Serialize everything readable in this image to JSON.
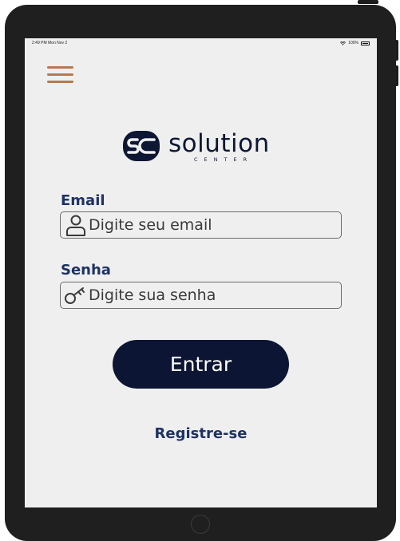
{
  "status_bar": {
    "time": "2:49 PM  Mon Nov 2",
    "battery_text": "100%",
    "wifi_icon": "wifi-icon",
    "battery_icon": "battery-icon"
  },
  "menu": {
    "icon": "hamburger-menu-icon"
  },
  "logo": {
    "mark_text": "SC",
    "word": "solution",
    "sub": "CENTER"
  },
  "form": {
    "email_label": "Email",
    "email_placeholder": "Digite seu email",
    "email_icon": "user-icon",
    "senha_label": "Senha",
    "senha_placeholder": "Digite sua senha",
    "senha_icon": "key-icon",
    "submit_label": "Entrar",
    "register_link": "Registre-se"
  },
  "colors": {
    "accent_menu": "#b8794c",
    "primary_dark": "#0c1533",
    "label_blue": "#1e3364",
    "screen_bg": "#efefef",
    "device_frame": "#1f1f1f"
  }
}
